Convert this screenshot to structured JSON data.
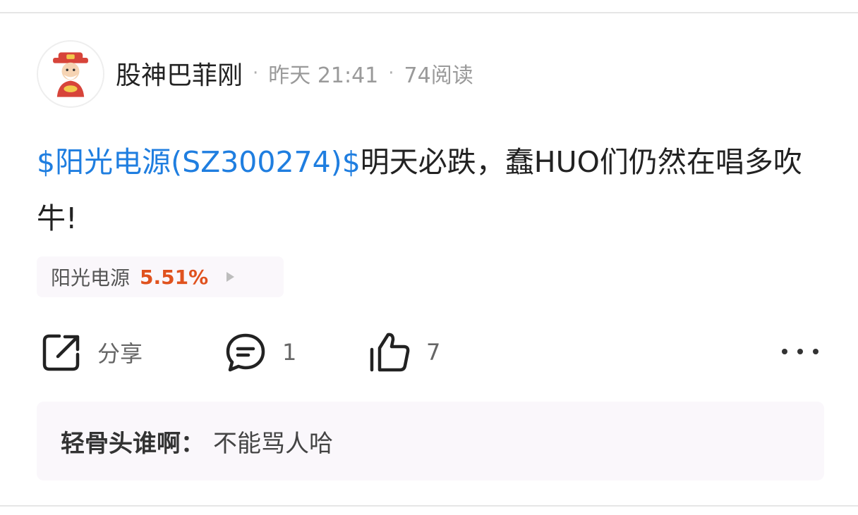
{
  "post": {
    "author": "股神巴菲刚",
    "time": "昨天 21:41",
    "reads": "74阅读",
    "stock_tag": "$阳光电源(SZ300274)$",
    "body": "明天必跌，蠢HUO们仍然在唱多吹牛!"
  },
  "stock_chip": {
    "name": "阳光电源",
    "change": "5.51%"
  },
  "actions": {
    "share_label": "分享",
    "comment_count": "1",
    "like_count": "7"
  },
  "comment": {
    "author": "轻骨头谁啊",
    "separator": "：",
    "text": "不能骂人哈"
  },
  "colors": {
    "link": "#1f7ee0",
    "change_up": "#e0521e",
    "panel_bg": "#faf7fb"
  },
  "icons": [
    "avatar-image",
    "share-icon",
    "comment-icon",
    "like-icon",
    "more-icon",
    "chevron-right-icon"
  ]
}
